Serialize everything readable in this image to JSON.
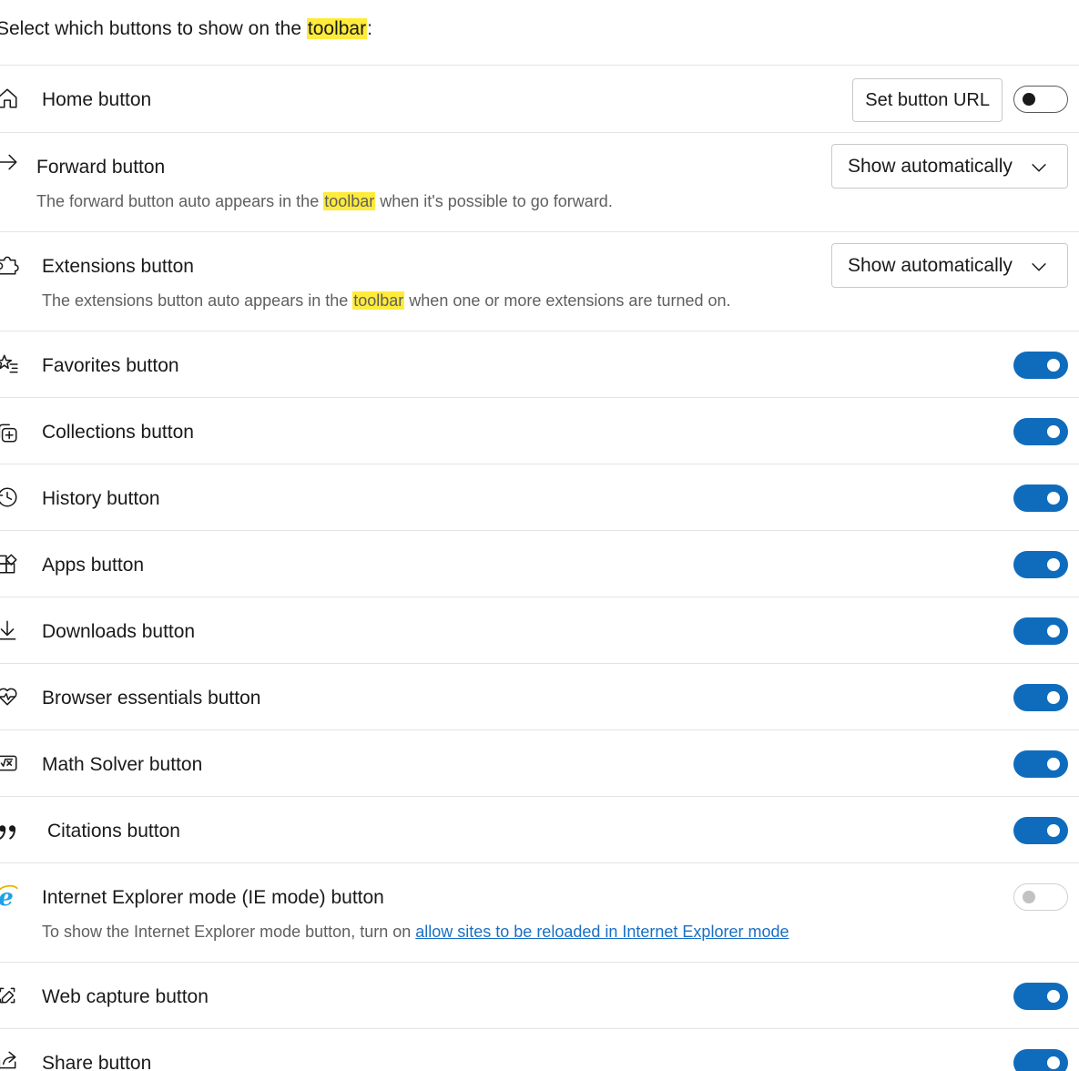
{
  "header": {
    "prefix": "Select which buttons to show on the ",
    "highlight": "toolbar",
    "suffix": ":"
  },
  "rows": [
    {
      "label": "Home button",
      "icon": "home-icon",
      "set_url_label": "Set button URL",
      "toggle": "off"
    },
    {
      "label": "Forward button",
      "icon": "arrow-right-icon",
      "select_value": "Show automatically",
      "desc_prefix": "The forward button auto appears in the ",
      "desc_highlight": "toolbar",
      "desc_suffix": " when it's possible to go forward."
    },
    {
      "label": "Extensions button",
      "icon": "puzzle-icon",
      "select_value": "Show automatically",
      "desc_prefix": "The extensions button auto appears in the ",
      "desc_highlight": "toolbar",
      "desc_suffix": " when one or more extensions are turned on."
    },
    {
      "label": "Favorites button",
      "icon": "star-list-icon",
      "toggle": "on"
    },
    {
      "label": "Collections button",
      "icon": "collections-icon",
      "toggle": "on"
    },
    {
      "label": "History button",
      "icon": "history-icon",
      "toggle": "on"
    },
    {
      "label": "Apps button",
      "icon": "apps-icon",
      "toggle": "on"
    },
    {
      "label": "Downloads button",
      "icon": "download-icon",
      "toggle": "on"
    },
    {
      "label": "Browser essentials button",
      "icon": "heart-pulse-icon",
      "toggle": "on"
    },
    {
      "label": "Math Solver button",
      "icon": "math-solver-icon",
      "toggle": "on"
    },
    {
      "label": "Citations button",
      "icon": "quote-icon",
      "toggle": "on"
    },
    {
      "label": "Internet Explorer mode (IE mode) button",
      "icon": "internet-explorer-icon",
      "toggle": "disabled",
      "desc_prefix": "To show the Internet Explorer mode button, turn on ",
      "desc_link": "allow sites to be reloaded in Internet Explorer mode"
    },
    {
      "label": "Web capture button",
      "icon": "web-capture-icon",
      "toggle": "on"
    },
    {
      "label": "Share button",
      "icon": "share-icon",
      "toggle": "on"
    }
  ],
  "colors": {
    "accent": "#0f6cbd",
    "highlight": "#ffeb3b",
    "link": "#1a6fc4",
    "ie_blue": "#1ea0e8"
  }
}
